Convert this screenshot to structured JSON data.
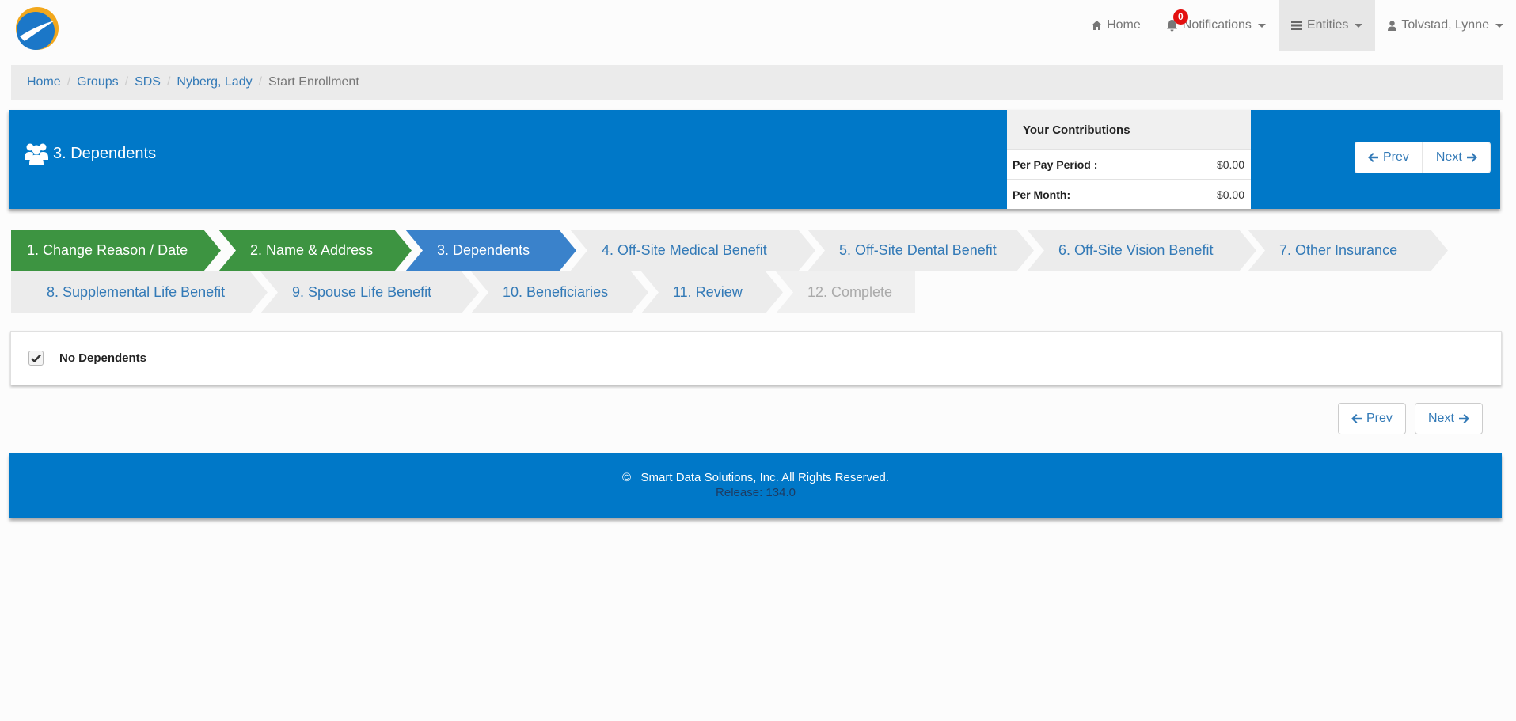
{
  "nav": {
    "home": "Home",
    "notifications": "Notifications",
    "notification_count": "0",
    "entities": "Entities",
    "user": "Tolvstad, Lynne"
  },
  "breadcrumb": {
    "items": [
      "Home",
      "Groups",
      "SDS",
      "Nyberg, Lady"
    ],
    "current": "Start Enrollment"
  },
  "header": {
    "title": "3. Dependents",
    "icon": "users-icon"
  },
  "contributions": {
    "title": "Your Contributions",
    "rows": [
      {
        "label": "Per Pay Period :",
        "value": "$0.00"
      },
      {
        "label": "Per Month:",
        "value": "$0.00"
      }
    ]
  },
  "pager": {
    "prev": "Prev",
    "next": "Next"
  },
  "steps": [
    {
      "label": "1. Change Reason / Date",
      "state": "done"
    },
    {
      "label": "2. Name & Address",
      "state": "done"
    },
    {
      "label": "3. Dependents",
      "state": "current"
    },
    {
      "label": "4. Off-Site Medical Benefit",
      "state": "todo"
    },
    {
      "label": "5. Off-Site Dental Benefit",
      "state": "todo"
    },
    {
      "label": "6. Off-Site Vision Benefit",
      "state": "todo"
    },
    {
      "label": "7. Other Insurance",
      "state": "todo"
    },
    {
      "label": "8. Supplemental Life Benefit",
      "state": "todo"
    },
    {
      "label": "9. Spouse Life Benefit",
      "state": "todo"
    },
    {
      "label": "10. Beneficiaries",
      "state": "todo"
    },
    {
      "label": "11. Review",
      "state": "todo"
    },
    {
      "label": "12. Complete",
      "state": "disabled"
    }
  ],
  "dependents": {
    "no_dependents_label": "No Dependents",
    "no_dependents_checked": true
  },
  "footer": {
    "copyright_symbol": "©",
    "copyright": "Smart Data Solutions, Inc. All Rights Reserved.",
    "release": "Release: 134.0"
  },
  "colors": {
    "brand_blue": "#0078c8",
    "step_done": "#3d9441",
    "step_current": "#3a82cb",
    "step_todo": "#ececec",
    "link": "#337ab7",
    "badge": "#e31010"
  }
}
